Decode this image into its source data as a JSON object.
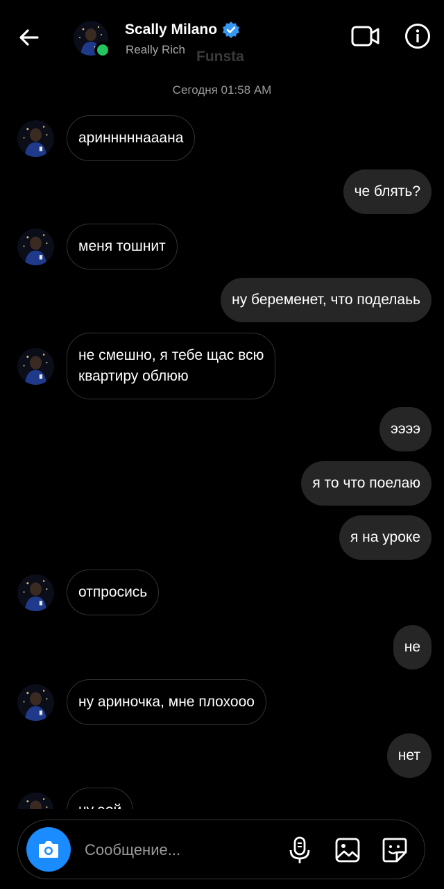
{
  "header": {
    "name": "Scally Milano",
    "subtitle": "Really Rich",
    "overlay_text": "Funsta",
    "online": true
  },
  "conversation": {
    "timestamp": "Сегодня 01:58 AM"
  },
  "messages": [
    {
      "dir": "in",
      "text": "аринннннааана"
    },
    {
      "dir": "out",
      "text": "че блять?"
    },
    {
      "dir": "in",
      "text": "меня тошнит"
    },
    {
      "dir": "out",
      "text": "ну беременет, что поделаьь"
    },
    {
      "dir": "in",
      "text": "не смешно, я тебе щас всю\nквартиру облюю"
    },
    {
      "dir": "out",
      "text": "ээээ"
    },
    {
      "dir": "out",
      "text": "я то что поелаю"
    },
    {
      "dir": "out",
      "text": "я на уроке"
    },
    {
      "dir": "in",
      "text": "отпросись"
    },
    {
      "dir": "out",
      "text": "не"
    },
    {
      "dir": "in",
      "text": "ну ариночка, мне плохооо"
    },
    {
      "dir": "out",
      "text": "нет"
    },
    {
      "dir": "in",
      "text": "ну эой"
    }
  ],
  "composer": {
    "placeholder": "Сообщение..."
  },
  "colors": {
    "accent": "#1a8cff",
    "online": "#22c55e",
    "verified": "#3897f0",
    "outgoing_bubble": "#262626"
  },
  "icons": [
    "back-arrow-icon",
    "verified-badge-icon",
    "video-call-icon",
    "info-icon",
    "camera-icon",
    "microphone-icon",
    "gallery-icon",
    "sticker-icon"
  ]
}
